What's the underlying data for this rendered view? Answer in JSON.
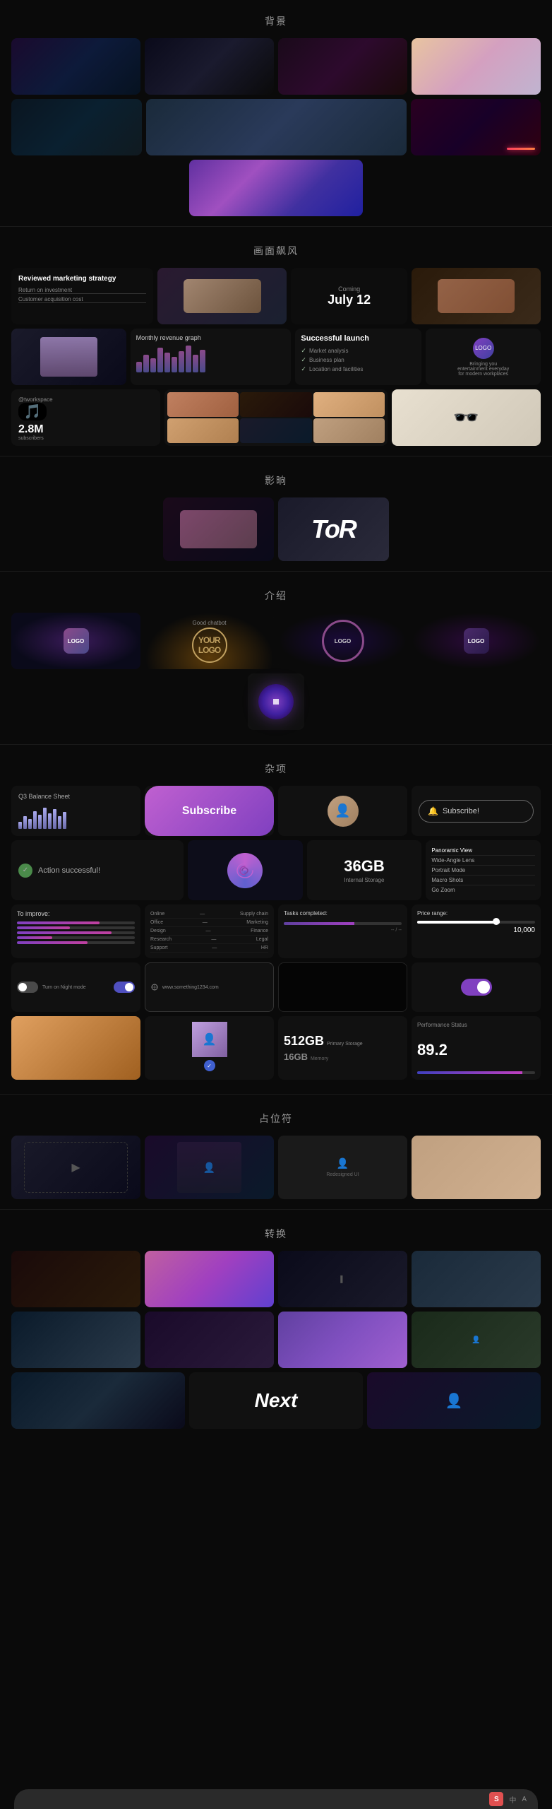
{
  "sections": {
    "backgrounds": {
      "title": "背景",
      "items": [
        {
          "bg": "bg1"
        },
        {
          "bg": "bg2"
        },
        {
          "bg": "bg3"
        },
        {
          "bg": "bg4"
        },
        {
          "bg": "bg5"
        },
        {
          "bg": "bg6"
        },
        {
          "bg": "bg7"
        },
        {
          "bg": "bg8"
        },
        {
          "bg": "bg9"
        }
      ]
    },
    "scene": {
      "title": "画面飙风",
      "text_card": {
        "title": "Reviewed marketing strategy",
        "lines": [
          "Return on investment",
          "Customer acquisition cost"
        ]
      },
      "coming": {
        "label": "Coming",
        "date": "July 12"
      },
      "tiktok": {
        "handle": "@tworkspace",
        "count": "2.8M",
        "label": "subscribers"
      }
    },
    "effects": {
      "title": "影晌"
    },
    "intro": {
      "title": "介绍",
      "good_chat": "Good chatbot"
    },
    "misc": {
      "title": "杂项",
      "balance": "Q3  Balance Sheet",
      "subscribe_label": "Subscribe",
      "subscribe_outline_label": "Subscribe!",
      "action_label": "Action successful!",
      "storage_amount": "36GB",
      "storage_label": "Internal Storage",
      "menu_items": [
        "Panoramic View",
        "Wide-Angle Lens",
        "Portrait Mode",
        "Macro Shots",
        "Go Zoom"
      ],
      "improve_title": "To improve:",
      "tasks_title": "Tasks completed:",
      "price_title": "Price range:",
      "price_value": "10,000",
      "storage2_big": "512GB",
      "storage2_med": "16GB",
      "perf_label": "Performance Status",
      "perf_score": "89.2",
      "toggle_label": "Turn on Night mode",
      "url_label": "www.something1234.com"
    },
    "placeholders": {
      "title": "占位符",
      "redesigned_label": "Redesigned UI"
    },
    "transitions": {
      "title": "转换",
      "next_label": "Next"
    }
  },
  "bottom_bar": {
    "lang": "中",
    "lang2": "A"
  }
}
